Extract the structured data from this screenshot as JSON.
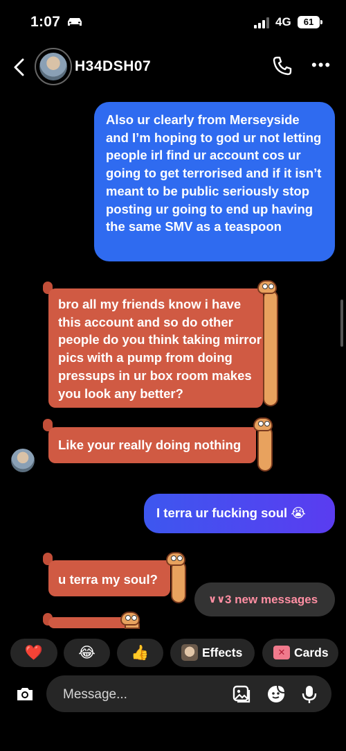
{
  "status_bar": {
    "time": "1:07",
    "network": "4G",
    "battery": "61",
    "icons": [
      "car-icon",
      "signal-icon",
      "battery-icon"
    ]
  },
  "header": {
    "username": "H34DSH07",
    "icons": [
      "back-chevron-icon",
      "phone-icon",
      "more-options-icon"
    ]
  },
  "messages": [
    {
      "direction": "outgoing",
      "text": "Also ur clearly from Merseyside and I’m hoping to god ur not letting people irl find ur account cos ur going to get terrorised and if it isn’t meant to be public seriously stop posting ur going to end up having the same SMV as a teaspoon"
    },
    {
      "direction": "incoming",
      "text": "bro all my friends know i have this account and so do other people do you think taking mirror pics with a pump from doing pressups in ur box room makes you look any better?"
    },
    {
      "direction": "incoming",
      "text": "Like your really doing nothing"
    },
    {
      "direction": "outgoing",
      "text": "I terra ur fucking soul 😭"
    },
    {
      "direction": "incoming",
      "text": "u terra my soul?"
    }
  ],
  "new_messages_label": "3 new messages",
  "quick_reactions": [
    "❤️",
    "😂",
    "👍"
  ],
  "effects_label": "Effects",
  "cards_label": "Cards",
  "composer": {
    "placeholder": "Message...",
    "icons": [
      "camera-icon",
      "gallery-icon",
      "sticker-icon",
      "microphone-icon"
    ]
  },
  "colors": {
    "outgoing_bubble": "#2f6bf0",
    "incoming_bubble": "#d05a43",
    "new_messages_text": "#ff8fa3"
  }
}
